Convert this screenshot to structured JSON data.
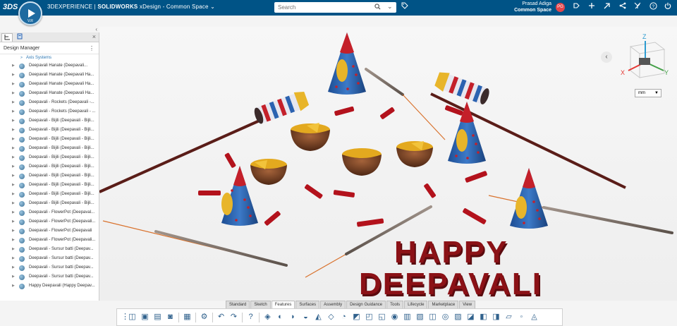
{
  "header": {
    "brand_logo": "3DS",
    "brand_prefix": "3D",
    "brand_experience": "EXPERIENCE",
    "brand_sep": " | ",
    "brand_solidworks": "SOLIDWORKS",
    "app_title": " xDesign - Common Space",
    "chevron": "⌄",
    "compass_label": "V.R",
    "search_placeholder": "Search",
    "user_name": "Prasad Adiga",
    "user_space": "Common Space",
    "user_initials": "PG"
  },
  "icons": {
    "compass": "compass-icon",
    "search": "search-icon",
    "tag": "tag-icon"
  },
  "left_panel": {
    "collapse_glyph": "‹",
    "close_glyph": "×",
    "title": "Design Manager",
    "menu_glyph": "⋮",
    "axis_item": "Axis Systems",
    "items": [
      "Deepavali Hanate (Deepavali...",
      "Deepavali Hanate (Deepavali Ha...",
      "Deepavali Hanate (Deepavali Ha...",
      "Deepavali Hanate (Deepavali Ha...",
      "Deepavali - Rockets (Deepavali -...",
      "Deepavali - Rockets (Deepavali - ...",
      "Deepavali - Bijili (Deepavali - Bijli...",
      "Deepavali - Bijili (Deepavali - Bijli...",
      "Deepavali - Bijili (Deepavali - Bijli...",
      "Deepavali - Bijili (Deepavali - Bijli...",
      "Deepavali - Bijili (Deepavali - Bijli...",
      "Deepavali - Bijili (Deepavali - Bijli...",
      "Deepavali - Bijili (Deepavali - Bijli...",
      "Deepavali - Bijili (Deepavali - Bijli...",
      "Deepavali - Bijili (Deepavali - Bijli...",
      "Deepavali - Bijili (Deepavali - Bijli...",
      "Deepavali - FlowerPot (Deepaval...",
      "Deepavali - FlowerPot (Deepavali...",
      "Deepavali - FlowerPot (Deepavali",
      "Deepavali - FlowerPot (Deepavali...",
      "Deepavali - Sursur batti (Deepav...",
      "Deepavali - Sursur batti (Deepav...",
      "Deepavali - Sursur batti (Deepav...",
      "Deepavali - Sursur batti (Deepav...",
      "Happy Deepavali (Happy Deepav..."
    ]
  },
  "canvas": {
    "text_line1": "HAPPY",
    "text_line2": "DEEPAVALI",
    "triad": {
      "z": "Z",
      "x": "X",
      "y": "Y"
    },
    "unit": "mm",
    "collapse_glyph": "‹",
    "colors": {
      "firecracker_red": "#c4202a",
      "cone_blue": "#2b62b0",
      "cone_tip": "#c4202a",
      "gold": "#e8b52a",
      "letters": "#8b1116",
      "diya": "#7a4221",
      "sparkler": "#7b6f66"
    }
  },
  "command_tabs": [
    "Standard",
    "Sketch",
    "Features",
    "Surfaces",
    "Assembly",
    "Design Guidance",
    "Tools",
    "Lifecycle",
    "Marketplace",
    "View"
  ],
  "command_active": "Features",
  "action_icons": [
    "grip-icon",
    "new-part-icon",
    "open-icon",
    "save-icon",
    "save-as-icon",
    "print-icon",
    "settings-icon",
    "undo-icon",
    "redo-icon",
    "help-icon",
    "extrude-icon",
    "revolve-icon",
    "sweep-icon",
    "loft-icon",
    "thicken-icon",
    "cut-icon",
    "fillet-icon",
    "chamfer-icon",
    "shell-icon",
    "draft-icon",
    "hole-icon",
    "rib-icon",
    "pattern-icon",
    "mirror-icon",
    "boolean-icon",
    "scale-icon",
    "split-icon",
    "move-face-icon",
    "delete-face-icon",
    "plane-icon",
    "point-icon",
    "measure-icon"
  ]
}
